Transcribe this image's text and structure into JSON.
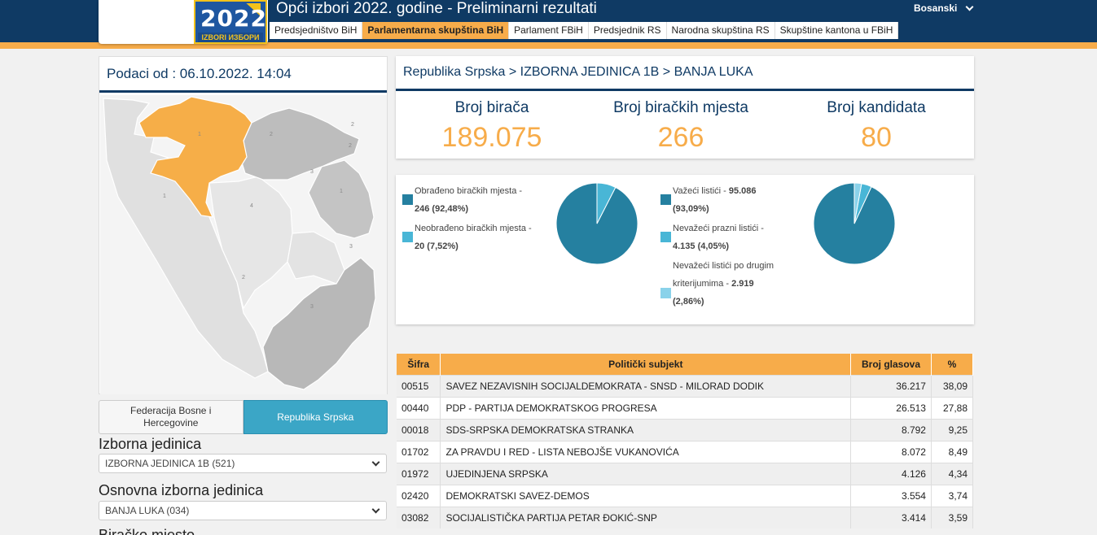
{
  "header": {
    "logo_year": "2022",
    "logo_sub": "IZBORI ИЗБОРИ",
    "title": "Opći izbori 2022. godine - Preliminarni rezultati",
    "language": "Bosanski",
    "tabs": [
      {
        "label": "Predsjedništvo BiH",
        "active": false
      },
      {
        "label": "Parlamentarna skupština BiH",
        "active": true
      },
      {
        "label": "Parlament FBiH",
        "active": false
      },
      {
        "label": "Predsjednik RS",
        "active": false
      },
      {
        "label": "Narodna skupština RS",
        "active": false
      },
      {
        "label": "Skupštine kantona u FBiH",
        "active": false
      }
    ]
  },
  "left": {
    "data_from": "Podaci od : 06.10.2022. 14:04",
    "zoom_in": "+",
    "zoom_out": "-",
    "map_labels": [
      "1",
      "2",
      "2",
      "1",
      "3",
      "2",
      "4",
      "1",
      "3",
      "2",
      "3"
    ],
    "entity_fbih": "Federacija Bosne i Hercegovine",
    "entity_rs": "Republika Srpska",
    "unit_label": "Izborna jedinica",
    "unit_value": "IZBORNA JEDINICA 1B (521)",
    "basic_unit_label": "Osnovna izborna jedinica",
    "basic_unit_value": "BANJA LUKA (034)",
    "polling_label": "Biračko mjesto"
  },
  "summary": {
    "breadcrumb": "Republika Srpska > IZBORNA JEDINICA 1B > BANJA LUKA",
    "voters_label": "Broj birača",
    "voters_value": "189.075",
    "stations_label": "Broj biračkih mjesta",
    "stations_value": "266",
    "candidates_label": "Broj kandidata",
    "candidates_value": "80"
  },
  "processing": {
    "processed_label": "Obrađeno biračkih mjesta -",
    "processed_value": "246 (92,48%)",
    "unprocessed_label": "Neobrađeno biračkih mjesta -",
    "unprocessed_value": "20 (7,52%)",
    "slices": [
      92.48,
      7.52
    ],
    "colors": [
      "#2580a0",
      "#49b6d6"
    ]
  },
  "ballots": {
    "valid_label": "Važeći listići -",
    "valid_value": "95.086",
    "valid_pct": "(93,09%)",
    "blank_label": "Nevažeći prazni listići -",
    "blank_value": "4.135 (4,05%)",
    "other_label_1": "Nevažeći listići po drugim",
    "other_label_2": "kriterijumima -",
    "other_value": "2.919",
    "other_pct": "(2,86%)",
    "slices": [
      93.09,
      4.05,
      2.86
    ],
    "colors": [
      "#2580a0",
      "#49b6d6",
      "#8ad2ea"
    ]
  },
  "table": {
    "headers": [
      "Šifra",
      "Politički subjekt",
      "Broj glasova",
      "%"
    ],
    "rows": [
      {
        "code": "00515",
        "name": "SAVEZ NEZAVISNIH SOCIJALDEMOKRATA - SNSD - MILORAD DODIK",
        "votes": "36.217",
        "pct": "38,09"
      },
      {
        "code": "00440",
        "name": "PDP - PARTIJA DEMOKRATSKOG PROGRESA",
        "votes": "26.513",
        "pct": "27,88"
      },
      {
        "code": "00018",
        "name": "SDS-SRPSKA DEMOKRATSKA STRANKA",
        "votes": "8.792",
        "pct": "9,25"
      },
      {
        "code": "01702",
        "name": "ZA PRAVDU I RED - LISTA NEBOJŠE VUKANOVIĆA",
        "votes": "8.072",
        "pct": "8,49"
      },
      {
        "code": "01972",
        "name": "UJEDINJENA SRPSKA",
        "votes": "4.126",
        "pct": "4,34"
      },
      {
        "code": "02420",
        "name": "DEMOKRATSKI SAVEZ-DEMOS",
        "votes": "3.554",
        "pct": "3,74"
      },
      {
        "code": "03082",
        "name": "SOCIJALISTIČKA PARTIJA PETAR ĐOKIĆ-SNP",
        "votes": "3.414",
        "pct": "3,59"
      }
    ]
  },
  "colors": {
    "navy": "#0f3a64",
    "orange": "#f7ac4a",
    "teal": "#3ba6c6"
  }
}
